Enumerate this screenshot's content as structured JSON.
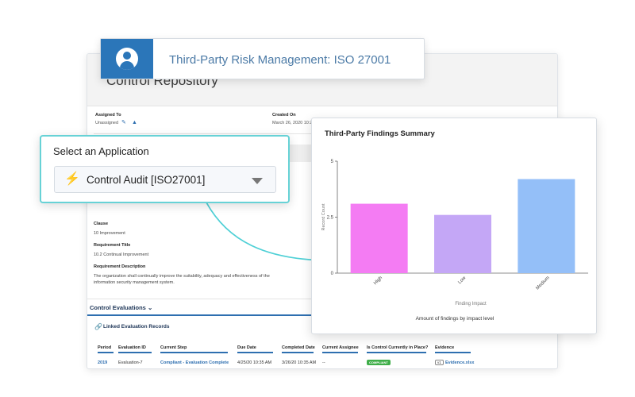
{
  "banner": {
    "title": "Third-Party Risk Management: ISO 27001",
    "icon": "user-icon",
    "icon_bg": "#2b76b9"
  },
  "repository": {
    "title": "Control Repository",
    "assigned_to_label": "Assigned To",
    "assigned_to_value": "Unassigned",
    "created_on_label": "Created On",
    "created_on_value": "March 26, 2020 10:29",
    "fields": [
      {
        "label": "Clause",
        "value": "10 Improvement"
      },
      {
        "label": "Requirement Title",
        "value": "10.2 Continual Improvement"
      },
      {
        "label": "Requirement Description",
        "value": "The organization shall continually improve the suitability, adequacy and effectiveness of the information security management system."
      }
    ],
    "section_title": "Control Evaluations",
    "linked_title": "Linked Evaluation Records",
    "table": {
      "headers": [
        "Period",
        "Evaluation ID",
        "Current Step",
        "Due Date",
        "Completed Date",
        "Current Assignee",
        "Is Control Currently in Place?",
        "Evidence"
      ],
      "rows": [
        {
          "period": "2019",
          "evaluation_id": "Evaluation-7",
          "current_step": "Compliant - Evaluation Complete",
          "due_date": "4/25/20 10:35 AM",
          "completed_date": "3/26/20 10:35 AM",
          "assignee": "--",
          "in_place": "COMPLIANT",
          "version": "v1",
          "evidence": "Evidence.xlsx"
        }
      ]
    }
  },
  "app_selector": {
    "label": "Select an Application",
    "value": "Control Audit [ISO27001]",
    "icon": "bolt-icon",
    "icon_color": "#f15bd6"
  },
  "chart_card": {
    "title": "Third-Party Findings Summary",
    "caption": "Amount of findings by impact level"
  },
  "chart_data": {
    "type": "bar",
    "title": "Third-Party Findings Summary",
    "categories": [
      "High",
      "Low",
      "Medium"
    ],
    "values": [
      3.1,
      2.6,
      4.2
    ],
    "colors": [
      "#f47cf3",
      "#c4a7f6",
      "#94bff8"
    ],
    "xlabel": "Finding Impact",
    "ylabel": "Record Count",
    "ylim": [
      0,
      5
    ],
    "yticks": [
      "0",
      "2.5",
      "5"
    ],
    "grid": false
  }
}
